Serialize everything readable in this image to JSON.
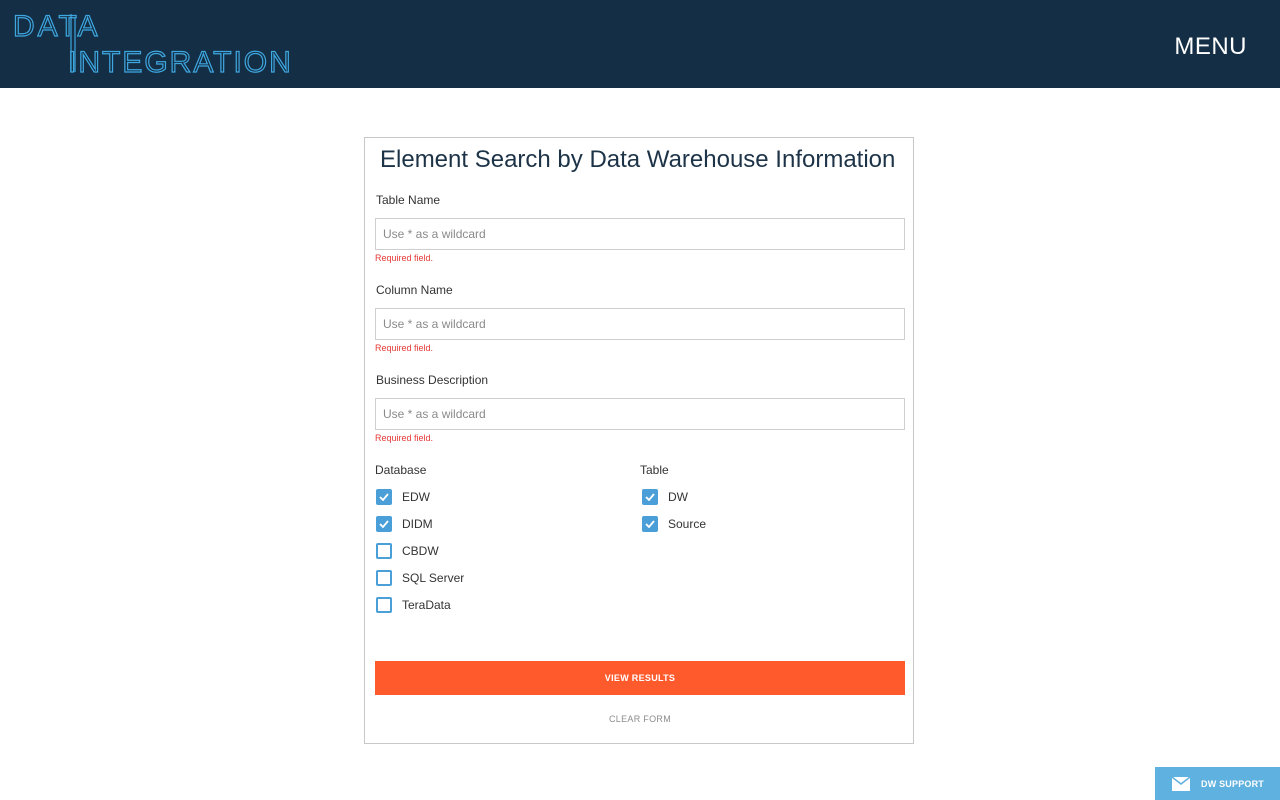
{
  "header": {
    "logo_line1": "DATA",
    "logo_line2": "INTEGRATION",
    "menu_label": "MENU",
    "bg_color": "#132e45"
  },
  "form": {
    "title": "Element Search by Data Warehouse Information",
    "fields": [
      {
        "label": "Table Name",
        "value": "",
        "placeholder": "Use * as a wildcard",
        "error": "Required field."
      },
      {
        "label": "Column Name",
        "value": "",
        "placeholder": "Use * as a wildcard",
        "error": "Required field."
      },
      {
        "label": "Business Description",
        "value": "",
        "placeholder": "Use * as a wildcard",
        "error": "Required field."
      }
    ],
    "database_group": {
      "label": "Database",
      "options": [
        {
          "label": "EDW",
          "checked": true
        },
        {
          "label": "DIDM",
          "checked": true
        },
        {
          "label": "CBDW",
          "checked": false
        },
        {
          "label": "SQL Server",
          "checked": false
        },
        {
          "label": "TeraData",
          "checked": false
        }
      ]
    },
    "table_group": {
      "label": "Table",
      "options": [
        {
          "label": "DW",
          "checked": true
        },
        {
          "label": "Source",
          "checked": true
        }
      ]
    },
    "submit_label": "VIEW RESULTS",
    "clear_label": "CLEAR FORM"
  },
  "support": {
    "label": "DW SUPPORT",
    "icon": "envelope-icon"
  },
  "colors": {
    "accent": "#ff5a2c",
    "checkbox": "#4a9fd8",
    "error": "#e53935",
    "support": "#5fb1df"
  }
}
